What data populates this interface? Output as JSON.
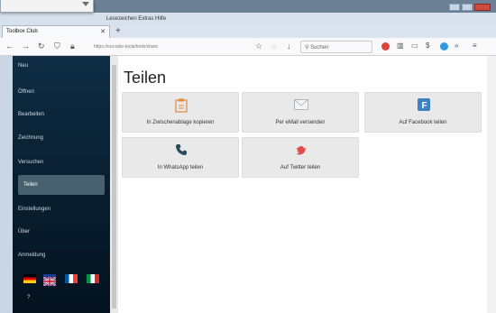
{
  "browser": {
    "tab_title": "Toolbox Club",
    "new_tab": "+",
    "menu_text": "Lesezeichen Extras Hilfe",
    "url": "https://our.tube-tools/tools/share",
    "search_placeholder": "Suchen"
  },
  "sidebar": {
    "items": [
      {
        "label": "Neu"
      },
      {
        "label": "Öffnen"
      },
      {
        "label": "Bearbeiten"
      },
      {
        "label": "Zeichnung"
      },
      {
        "label": "Versuchen"
      },
      {
        "label": "Teilen",
        "active": true
      },
      {
        "label": "Einstellungen"
      },
      {
        "label": "Über"
      },
      {
        "label": "Anmeldung"
      }
    ],
    "flags": [
      "German flag",
      "UK flag",
      "French flag",
      "Italian flag"
    ],
    "footer": "?"
  },
  "main": {
    "title": "Teilen",
    "cards": [
      {
        "label": "In Zwischenablage kopieren",
        "icon": "clipboard-icon"
      },
      {
        "label": "Per eMail versenden",
        "icon": "mail-icon"
      },
      {
        "label": "Auf Facebook teilen",
        "icon": "facebook-icon"
      },
      {
        "label": "In WhatsApp teilen",
        "icon": "phone-icon"
      },
      {
        "label": "Auf Twitter teilen",
        "icon": "twitter-icon"
      }
    ]
  },
  "colors": {
    "sidebar_bg": "#0b2a40",
    "active_item": "#49606f",
    "card_bg": "#e9e9e9"
  }
}
